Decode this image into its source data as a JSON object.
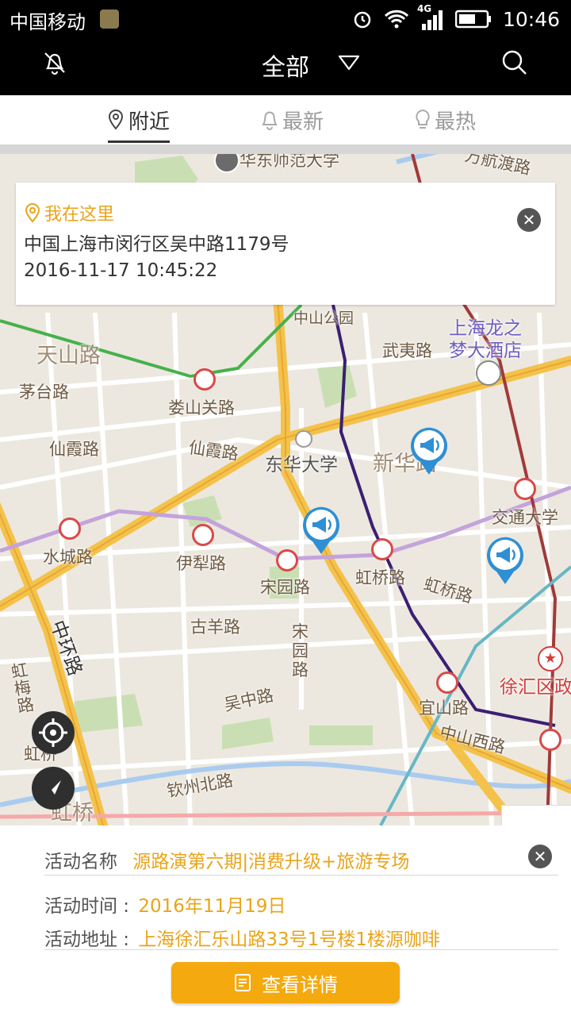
{
  "status_bar": {
    "carrier": "中国移动",
    "network": "4G",
    "time": "10:46"
  },
  "toolbar": {
    "title": "全部"
  },
  "tabs": [
    {
      "label": "附近",
      "active": true
    },
    {
      "label": "最新",
      "active": false
    },
    {
      "label": "最热",
      "active": false
    }
  ],
  "map": {
    "labels": {
      "east_china_normal": "华东师范大学",
      "wanhang": "万航渡路",
      "zhongshan_park": "中山公园",
      "wuyi": "武夷路",
      "longzhimeng_1": "上海龙之",
      "longzhimeng_2": "梦大酒店",
      "tianshan": "天山路",
      "maotai": "茅台路",
      "loushanguan": "娄山关路",
      "xianxia_1": "仙霞路",
      "xianxia_2": "仙霞路",
      "donghua": "东华大学",
      "xinhua": "新华路",
      "jiaotong": "交通大学",
      "shuicheng": "水城路",
      "yili": "伊犁路",
      "songyuan": "宋园路",
      "hongqiao_rd": "虹桥路",
      "hongqiao_rd2": "虹桥路",
      "guyang": "古羊路",
      "songyuan_v": "宋园路",
      "zhonghuan": "中环路",
      "hongmei": "虹梅路",
      "wuzhong": "吴中路",
      "yishan": "宜山路",
      "zhongshanxi": "中山西路",
      "xuhui": "徐汇区政",
      "hongqiao_1": "虹桥",
      "hongqiao_2": "虹桥",
      "qinzhou": "钦州北路"
    }
  },
  "location_card": {
    "heading": "我在这里",
    "address": "中国上海市闵行区吴中路1179号",
    "timestamp": "2016-11-17 10:45:22"
  },
  "event_sheet": {
    "name_label": "活动名称",
    "name_value": "源路演第六期|消费升级+旅游专场",
    "time_label": "活动时间 :",
    "time_value": "2016年11月19日",
    "address_label": "活动地址 :",
    "address_value": "上海徐汇乐山路33号1号楼1楼源咖啡",
    "detail_button": "查看详情"
  },
  "colors": {
    "accent": "#f4a90f",
    "accent_text": "#e9a41a",
    "bar": "#000000",
    "metro_red": "#d84a4a"
  }
}
